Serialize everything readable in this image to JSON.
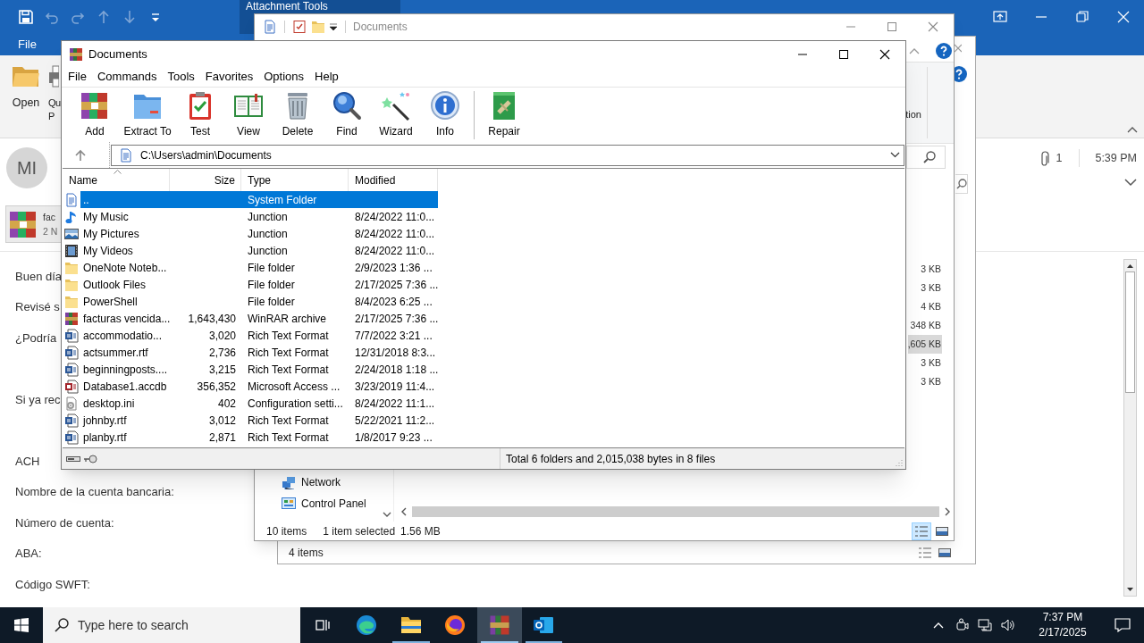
{
  "outlook": {
    "quick_access": [
      {
        "kind": "save",
        "disabled": false
      },
      {
        "kind": "undo",
        "disabled": true
      },
      {
        "kind": "redo",
        "disabled": true
      },
      {
        "kind": "up",
        "disabled": true
      },
      {
        "kind": "down",
        "disabled": true
      },
      {
        "kind": "customize",
        "disabled": false
      }
    ],
    "context_tab": "Attachment Tools",
    "ribbon_tabs": [
      {
        "label": "File"
      }
    ],
    "ribbon_buttons": [
      {
        "kind": "open",
        "label": "Open"
      },
      {
        "kind": "quick",
        "label": "Qu",
        "label_2": "P"
      }
    ],
    "sender_initials": "MI",
    "attachment_count": "1",
    "time": "5:39 PM",
    "attachment": {
      "name": "fac",
      "size": "2 N"
    },
    "body": [
      "Buen día",
      "Revisé s",
      "¿Podría",
      "Si ya rec",
      "ACH",
      "Nombre de la cuenta bancaria:",
      "Número de cuenta:",
      "ABA:",
      "Código SWFT:"
    ]
  },
  "explorer_back": {
    "status": "4 items"
  },
  "explorer": {
    "title": "Documents",
    "ribbon_label": "tion",
    "nav": [
      {
        "kind": "network",
        "label": "Network"
      },
      {
        "kind": "control",
        "label": "Control Panel"
      }
    ],
    "sizes": [
      {
        "text": "3 KB",
        "selected": false
      },
      {
        "text": "3 KB",
        "selected": false
      },
      {
        "text": "4 KB",
        "selected": false
      },
      {
        "text": "348 KB",
        "selected": false
      },
      {
        "text": ",605 KB",
        "selected": true
      },
      {
        "text": "3 KB",
        "selected": false
      },
      {
        "text": "3 KB",
        "selected": false
      }
    ],
    "status": {
      "count": "10 items",
      "selection": "1 item selected",
      "size": "1.56 MB"
    }
  },
  "winrar": {
    "title": "Documents",
    "menu": [
      "File",
      "Commands",
      "Tools",
      "Favorites",
      "Options",
      "Help"
    ],
    "toolbar": [
      {
        "kind": "add",
        "label": "Add"
      },
      {
        "kind": "extract",
        "label": "Extract To"
      },
      {
        "kind": "test",
        "label": "Test"
      },
      {
        "kind": "view",
        "label": "View"
      },
      {
        "kind": "delete",
        "label": "Delete"
      },
      {
        "kind": "find",
        "label": "Find"
      },
      {
        "kind": "wizard",
        "label": "Wizard"
      },
      {
        "kind": "info",
        "label": "Info"
      },
      {
        "kind": "repair",
        "label": "Repair"
      }
    ],
    "path": "C:\\Users\\admin\\Documents",
    "columns": [
      "Name",
      "Size",
      "Type",
      "Modified"
    ],
    "rows": [
      {
        "kind": "up",
        "name": "..",
        "size": "",
        "type": "System Folder",
        "modified": "",
        "selected": true
      },
      {
        "kind": "music",
        "name": "My Music",
        "size": "",
        "type": "Junction",
        "modified": "8/24/2022 11:0...",
        "selected": false
      },
      {
        "kind": "pictures",
        "name": "My Pictures",
        "size": "",
        "type": "Junction",
        "modified": "8/24/2022 11:0...",
        "selected": false
      },
      {
        "kind": "videos",
        "name": "My Videos",
        "size": "",
        "type": "Junction",
        "modified": "8/24/2022 11:0...",
        "selected": false
      },
      {
        "kind": "folder",
        "name": "OneNote Noteb...",
        "size": "",
        "type": "File folder",
        "modified": "2/9/2023 1:36 ...",
        "selected": false
      },
      {
        "kind": "folder",
        "name": "Outlook Files",
        "size": "",
        "type": "File folder",
        "modified": "2/17/2025 7:36 ...",
        "selected": false
      },
      {
        "kind": "folder",
        "name": "PowerShell",
        "size": "",
        "type": "File folder",
        "modified": "8/4/2023 6:25 ...",
        "selected": false
      },
      {
        "kind": "archive",
        "name": "facturas vencida...",
        "size": "1,643,430",
        "type": "WinRAR archive",
        "modified": "2/17/2025 7:36 ...",
        "selected": false
      },
      {
        "kind": "doc",
        "name": "accommodatio...",
        "size": "3,020",
        "type": "Rich Text Format",
        "modified": "7/7/2022 3:21 ...",
        "selected": false
      },
      {
        "kind": "doc",
        "name": "actsummer.rtf",
        "size": "2,736",
        "type": "Rich Text Format",
        "modified": "12/31/2018 8:3...",
        "selected": false
      },
      {
        "kind": "doc",
        "name": "beginningposts....",
        "size": "3,215",
        "type": "Rich Text Format",
        "modified": "2/24/2018 1:18 ...",
        "selected": false
      },
      {
        "kind": "access",
        "name": "Database1.accdb",
        "size": "356,352",
        "type": "Microsoft Access ...",
        "modified": "3/23/2019 11:4...",
        "selected": false
      },
      {
        "kind": "ini",
        "name": "desktop.ini",
        "size": "402",
        "type": "Configuration setti...",
        "modified": "8/24/2022 11:1...",
        "selected": false
      },
      {
        "kind": "doc",
        "name": "johnby.rtf",
        "size": "3,012",
        "type": "Rich Text Format",
        "modified": "5/22/2021 11:2...",
        "selected": false
      },
      {
        "kind": "doc",
        "name": "planby.rtf",
        "size": "2,871",
        "type": "Rich Text Format",
        "modified": "1/8/2017 9:23 ...",
        "selected": false
      }
    ],
    "status": "Total 6 folders and 2,015,038 bytes in 8 files"
  },
  "taskbar": {
    "search_placeholder": "Type here to search",
    "apps": [
      {
        "kind": "taskview",
        "running": false,
        "selected": false
      },
      {
        "kind": "edge",
        "running": false,
        "selected": false
      },
      {
        "kind": "explorer",
        "running": true,
        "selected": false
      },
      {
        "kind": "firefox",
        "running": false,
        "selected": false
      },
      {
        "kind": "winrar",
        "running": true,
        "selected": true
      },
      {
        "kind": "outlook",
        "running": true,
        "selected": false
      }
    ],
    "time": "7:37 PM",
    "date": "2/17/2025"
  }
}
